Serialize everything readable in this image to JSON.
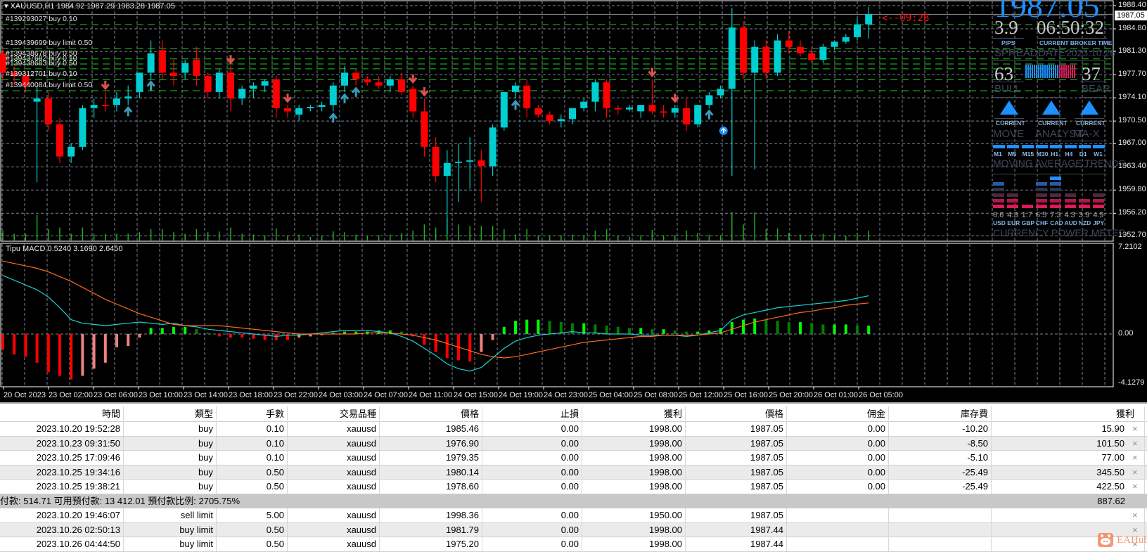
{
  "chart": {
    "title": "XAUUSD,H1  1984.92 1987.29 1983.28 1987.05",
    "countdown": "<--09:28",
    "current_price": "1987.05",
    "colors": {
      "bull": "#00CED1",
      "bear": "#FF0000",
      "order_line": "#22C022",
      "grid": "#7a8290",
      "volume": "#22b022",
      "arrow_up": "#3a9ab8",
      "arrow_down": "#e05050"
    },
    "price_axis": [
      "1988.40",
      "1984.80",
      "1981.30",
      "1977.70",
      "1974.10",
      "1970.50",
      "1967.00",
      "1963.40",
      "1959.80",
      "1956.20",
      "1952.70"
    ],
    "time_axis": [
      "20 Oct 2023",
      "23 Oct 02:00",
      "23 Oct 06:00",
      "23 Oct 10:00",
      "23 Oct 14:00",
      "23 Oct 18:00",
      "23 Oct 22:00",
      "24 Oct 03:00",
      "24 Oct 07:00",
      "24 Oct 11:00",
      "24 Oct 15:00",
      "24 Oct 19:00",
      "24 Oct 23:00",
      "25 Oct 04:00",
      "25 Oct 08:00",
      "25 Oct 12:00",
      "25 Oct 16:00",
      "25 Oct 20:00",
      "26 Oct 01:00",
      "26 Oct 05:00"
    ],
    "orders": [
      {
        "label": "#139293027 buy 0.10",
        "price": 1985.46
      },
      {
        "label": "#139439699 buy limit 0.50",
        "price": 1981.79
      },
      {
        "label": "#139438678 buy 0.50",
        "price": 1980.14
      },
      {
        "label": "#139437682 buy 0.10",
        "price": 1979.35
      },
      {
        "label": "#139438683 buy 0.50",
        "price": 1978.6
      },
      {
        "label": "#139312701 buy 0.10",
        "price": 1976.9
      },
      {
        "label": "#139440084 buy limit 0.50",
        "price": 1975.2
      }
    ],
    "candles": [
      [
        1981,
        1982,
        1977,
        1978
      ],
      [
        1978,
        1979,
        1976,
        1977.5
      ],
      [
        1977.5,
        1978,
        1975,
        1976
      ],
      [
        1973.5,
        1976,
        1961,
        1974
      ],
      [
        1974,
        1975,
        1969,
        1970
      ],
      [
        1970,
        1971,
        1964,
        1965
      ],
      [
        1965,
        1967,
        1964,
        1966.5
      ],
      [
        1966.5,
        1973,
        1966,
        1972.5
      ],
      [
        1972.5,
        1974,
        1971,
        1973
      ],
      [
        1973,
        1975,
        1972,
        1972.8
      ],
      [
        1973,
        1975,
        1972,
        1974
      ],
      [
        1974,
        1976,
        1973,
        1974.3
      ],
      [
        1975,
        1978,
        1974,
        1978
      ],
      [
        1978,
        1983,
        1977,
        1981
      ],
      [
        1981.5,
        1983,
        1977,
        1978
      ],
      [
        1978,
        1980,
        1976,
        1977.5
      ],
      [
        1978,
        1980,
        1977,
        1979.5
      ],
      [
        1980,
        1982,
        1976,
        1977.5
      ],
      [
        1977.5,
        1978,
        1974,
        1975
      ],
      [
        1975,
        1978.5,
        1974,
        1978
      ],
      [
        1978,
        1979,
        1972,
        1974
      ],
      [
        1974,
        1976,
        1973,
        1975.5
      ],
      [
        1975.5,
        1976.5,
        1974,
        1976
      ],
      [
        1976,
        1977,
        1975,
        1976.7
      ],
      [
        1977,
        1977.5,
        1971,
        1972.5
      ],
      [
        1972.5,
        1973,
        1971,
        1972
      ],
      [
        1971.5,
        1973,
        1970.5,
        1972.5
      ],
      [
        1972.5,
        1973,
        1972,
        1972.7
      ],
      [
        1972.7,
        1973.5,
        1972,
        1973
      ],
      [
        1973,
        1976.5,
        1972,
        1976
      ],
      [
        1976,
        1979,
        1975,
        1978
      ],
      [
        1978,
        1978.5,
        1976,
        1977
      ],
      [
        1977,
        1977.5,
        1976,
        1976.5
      ],
      [
        1976.5,
        1977.5,
        1975.5,
        1976
      ],
      [
        1976,
        1977.5,
        1975,
        1977
      ],
      [
        1977,
        1978,
        1974.5,
        1975
      ],
      [
        1975.5,
        1976,
        1971,
        1972
      ],
      [
        1972,
        1974,
        1965,
        1966.5
      ],
      [
        1966.5,
        1968,
        1961,
        1962
      ],
      [
        1962,
        1966,
        1953,
        1964
      ],
      [
        1964,
        1967,
        1958,
        1964.2
      ],
      [
        1964.2,
        1968,
        1960,
        1964.4
      ],
      [
        1964.4,
        1966,
        1958,
        1963.5
      ],
      [
        1963.5,
        1970,
        1962,
        1969.5
      ],
      [
        1969.5,
        1975,
        1969,
        1975
      ],
      [
        1975,
        1976.5,
        1974,
        1976
      ],
      [
        1976,
        1977,
        1971,
        1972.5
      ],
      [
        1972.5,
        1973,
        1971,
        1971.5
      ],
      [
        1971.5,
        1972,
        1970,
        1970.5
      ],
      [
        1970.5,
        1971.5,
        1969.5,
        1970.8
      ],
      [
        1970.8,
        1972.5,
        1970,
        1972.5
      ],
      [
        1972.5,
        1974,
        1972,
        1973.5
      ],
      [
        1973.5,
        1977,
        1972,
        1976.5
      ],
      [
        1976.5,
        1977,
        1971,
        1972.5
      ],
      [
        1972.5,
        1973,
        1971.5,
        1972.3
      ],
      [
        1972.3,
        1973,
        1972,
        1972.6
      ],
      [
        1972,
        1973,
        1971,
        1973
      ],
      [
        1973,
        1977,
        1971.5,
        1972
      ],
      [
        1972,
        1973,
        1971,
        1971.8
      ],
      [
        1971.8,
        1973,
        1971,
        1972.5
      ],
      [
        1972.5,
        1974,
        1969,
        1970
      ],
      [
        1970,
        1973,
        1969.5,
        1973
      ],
      [
        1973,
        1975,
        1972.5,
        1974.5
      ],
      [
        1974.5,
        1976,
        1974,
        1975.5
      ],
      [
        1975.5,
        1988,
        1962,
        1985
      ],
      [
        1985,
        1986,
        1977,
        1978
      ],
      [
        1978,
        1983,
        1963,
        1982
      ],
      [
        1982,
        1983,
        1977,
        1978
      ],
      [
        1978,
        1984,
        1977.5,
        1983
      ],
      [
        1983,
        1984.5,
        1981,
        1982
      ],
      [
        1982,
        1983,
        1980.5,
        1981
      ],
      [
        1981,
        1982,
        1979.5,
        1980
      ],
      [
        1980,
        1982.5,
        1979.5,
        1982
      ],
      [
        1982,
        1983,
        1981.5,
        1982.8
      ],
      [
        1982.8,
        1984,
        1982.5,
        1983.5
      ],
      [
        1983.5,
        1986.5,
        1983,
        1985.5
      ],
      [
        1985.5,
        1988.2,
        1983.28,
        1987.05
      ]
    ],
    "down_arrows": [
      9,
      20,
      25,
      36,
      37,
      57,
      59
    ],
    "up_arrows": [
      11,
      13,
      29,
      30,
      31,
      45,
      62
    ],
    "buy_signal": {
      "bar": 64,
      "price": 1969
    }
  },
  "macd": {
    "label": "Tipu MACD 0.5240 3.1690 2.6450",
    "axis": [
      "7.2102",
      "0.00",
      "-4.1279"
    ],
    "range": [
      -4.1279,
      7.2102
    ],
    "histogram": [
      -1.3,
      -1.7,
      -1.9,
      -2.4,
      -3.2,
      -3.5,
      -3.8,
      -3.5,
      -2.9,
      -2.4,
      -1.1,
      -1.0,
      -0.3,
      0.5,
      0.5,
      0.6,
      0.6,
      0.4,
      0.1,
      -0.2,
      -0.3,
      -0.3,
      -0.4,
      -0.5,
      -0.5,
      -0.5,
      -0.3,
      -0.2,
      -0.1,
      0.1,
      0.2,
      0.2,
      0.2,
      0.3,
      0.3,
      0.2,
      -0.2,
      -0.9,
      -1.5,
      -2.0,
      -2.2,
      -2.3,
      -1.5,
      -0.5,
      0.6,
      1.1,
      1.2,
      1.2,
      1.1,
      1.0,
      0.9,
      0.9,
      0.8,
      0.7,
      0.6,
      0.5,
      0.5,
      0.4,
      0.4,
      0.3,
      0.2,
      0.2,
      0.3,
      0.5,
      1.0,
      1.2,
      1.3,
      1.2,
      1.1,
      1.0,
      1.0,
      0.9,
      0.8,
      0.8,
      0.8,
      0.7,
      0.7
    ],
    "main": [
      4.9,
      4.5,
      4.1,
      3.7,
      3.1,
      2.2,
      1.2,
      0.9,
      0.8,
      0.7,
      0.8,
      0.9,
      1.0,
      0.9,
      0.8,
      0.9,
      0.7,
      0.6,
      0.4,
      0.3,
      0.2,
      0.1,
      0.0,
      -0.1,
      -0.2,
      -0.1,
      -0.1,
      0.0,
      0.1,
      0.2,
      0.3,
      0.3,
      0.3,
      0.2,
      0.1,
      -0.2,
      -0.6,
      -1.2,
      -1.8,
      -2.5,
      -2.9,
      -3.1,
      -2.8,
      -2.0,
      -1.2,
      -0.6,
      -0.3,
      -0.1,
      0.0,
      0.1,
      0.2,
      0.1,
      0.1,
      0.0,
      0.0,
      0.0,
      -0.1,
      -0.1,
      -0.1,
      -0.1,
      -0.2,
      -0.1,
      0.1,
      0.3,
      1.2,
      1.6,
      1.8,
      2.0,
      2.2,
      2.3,
      2.4,
      2.5,
      2.6,
      2.7,
      2.8,
      3.0,
      3.2
    ],
    "signal": [
      6.1,
      5.9,
      5.7,
      5.5,
      5.2,
      4.8,
      4.4,
      3.9,
      3.4,
      2.9,
      2.5,
      2.1,
      1.7,
      1.4,
      1.1,
      0.8,
      0.7,
      0.7,
      0.7,
      0.7,
      0.6,
      0.5,
      0.4,
      0.3,
      0.2,
      0.1,
      0.0,
      0.0,
      0.0,
      0.0,
      0.0,
      0.0,
      0.1,
      0.1,
      0.1,
      0.0,
      -0.1,
      -0.3,
      -0.5,
      -0.8,
      -1.1,
      -1.4,
      -1.7,
      -1.9,
      -2.0,
      -1.9,
      -1.7,
      -1.5,
      -1.3,
      -1.1,
      -0.9,
      -0.7,
      -0.6,
      -0.5,
      -0.4,
      -0.3,
      -0.2,
      -0.2,
      -0.1,
      -0.1,
      -0.1,
      -0.1,
      0.0,
      0.1,
      0.4,
      0.7,
      1.0,
      1.2,
      1.4,
      1.6,
      1.8,
      1.9,
      2.1,
      2.2,
      2.4,
      2.5,
      2.6
    ],
    "colors": {
      "main": "#20d0d0",
      "signal": "#ff6a20",
      "neg_strong": "#ff0000",
      "neg_weak": "#f08080",
      "pos_strong": "#00ff00",
      "pos_weak": "#008000"
    }
  },
  "dashboard": {
    "price": "1987.05",
    "spread": "3.9",
    "spread_unit": "PIPS",
    "spread_label": "SPREAD",
    "time": "06:50:32",
    "time_caption": "CURRENT BROKER TIME",
    "date_label": "DATE",
    "date": "2023.10.26",
    "bull": "63",
    "bull_label": "BULL",
    "bear": "37",
    "bear_label": "BEAR",
    "bull_fraction": 0.63,
    "signals": [
      {
        "caption": "CURRENT",
        "label": "MOVE",
        "direction": "up"
      },
      {
        "caption": "CURRENT",
        "label": "ANALYST",
        "direction": "up"
      },
      {
        "caption": "CURRENT",
        "label": "MA-X",
        "direction": "up"
      }
    ],
    "timeframes": [
      "M1",
      "M5",
      "M15",
      "M30",
      "H1",
      "H4",
      "D1",
      "W1"
    ],
    "ma_title": "MOVING AVERAGE TRENDS",
    "currencies": [
      {
        "code": "USD",
        "value": "6.6",
        "level": 5
      },
      {
        "code": "EUR",
        "value": "4.3",
        "level": 3
      },
      {
        "code": "GBP",
        "value": "1.7",
        "level": 1
      },
      {
        "code": "CHF",
        "value": "6.5",
        "level": 5
      },
      {
        "code": "CAD",
        "value": "7.3",
        "level": 6
      },
      {
        "code": "AUD",
        "value": "4.3",
        "level": 3
      },
      {
        "code": "NZD",
        "value": "3.9",
        "level": 2
      },
      {
        "code": "JPY",
        "value": "4.9",
        "level": 3
      }
    ],
    "meter_title": "CURRENCY POWER METER",
    "colors": {
      "accent": "#1E90FF",
      "bear": "#E0185A"
    }
  },
  "table": {
    "headers": [
      "時間",
      "類型",
      "手數",
      "交易品種",
      "價格",
      "止損",
      "獲利",
      "價格",
      "佣金",
      "庫存費",
      "獲利"
    ],
    "rows": [
      [
        "2023.10.20 19:52:28",
        "buy",
        "0.10",
        "xauusd",
        "1985.46",
        "0.00",
        "1998.00",
        "1987.05",
        "0.00",
        "-10.20",
        "15.90"
      ],
      [
        "2023.10.23 09:31:50",
        "buy",
        "0.10",
        "xauusd",
        "1976.90",
        "0.00",
        "1998.00",
        "1987.05",
        "0.00",
        "-8.50",
        "101.50"
      ],
      [
        "2023.10.25 17:09:46",
        "buy",
        "0.10",
        "xauusd",
        "1979.35",
        "0.00",
        "1998.00",
        "1987.05",
        "0.00",
        "-5.10",
        "77.00"
      ],
      [
        "2023.10.25 19:34:16",
        "buy",
        "0.50",
        "xauusd",
        "1980.14",
        "0.00",
        "1998.00",
        "1987.05",
        "0.00",
        "-25.49",
        "345.50"
      ],
      [
        "2023.10.25 19:38:21",
        "buy",
        "0.50",
        "xauusd",
        "1978.60",
        "0.00",
        "1998.00",
        "1987.05",
        "0.00",
        "-25.49",
        "422.50"
      ]
    ],
    "summary": {
      "text": "付款: 514.71  可用預付款: 13 412.01  預付款比例: 2705.75%",
      "profit": "887.62"
    },
    "pending": [
      [
        "2023.10.20 19:46:07",
        "sell limit",
        "5.00",
        "xauusd",
        "1998.36",
        "0.00",
        "1950.00",
        "1987.05",
        "",
        "",
        ""
      ],
      [
        "2023.10.26 02:50:13",
        "buy limit",
        "0.50",
        "xauusd",
        "1981.79",
        "0.00",
        "1998.00",
        "1987.44",
        "",
        "",
        ""
      ],
      [
        "2023.10.26 04:44:50",
        "buy limit",
        "0.50",
        "xauusd",
        "1975.20",
        "0.00",
        "1998.00",
        "1987.44",
        "",
        "",
        ""
      ]
    ],
    "close_symbol": "×"
  },
  "watermark": {
    "text": "EAHub"
  }
}
